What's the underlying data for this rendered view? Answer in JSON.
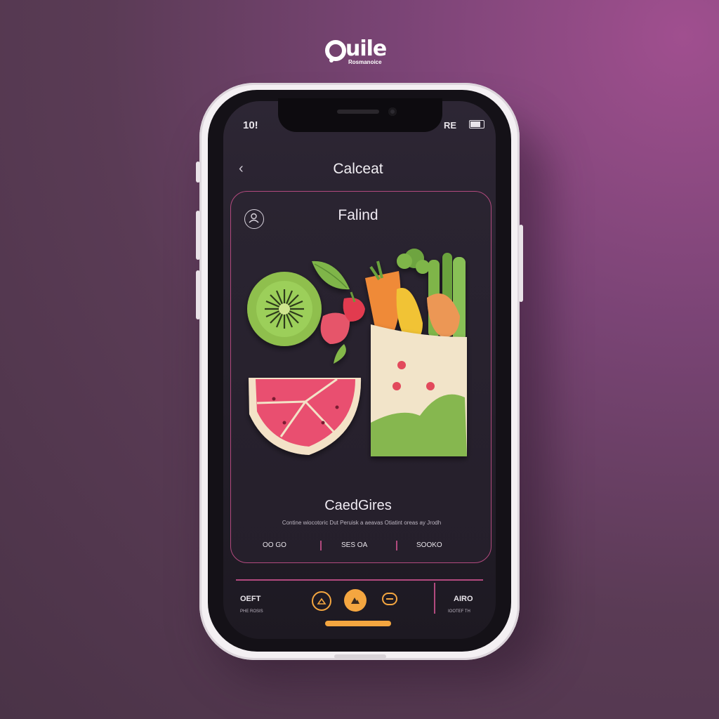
{
  "brand": {
    "logo_text": "uile",
    "logo_subtext": "Rosmanoice"
  },
  "status_bar": {
    "time": "10!",
    "signal_text": "RE"
  },
  "header": {
    "back_icon": "chevron-left-icon",
    "title": "Calceat"
  },
  "card": {
    "badge_icon": "profile-icon",
    "title": "Falind",
    "subtitle": "CaedGires",
    "description": "Contine wiocotoric Dut Peruisk a aeavas Otiatint oreas ay Jrodh",
    "stats": [
      "OO GO",
      "SES OA",
      "SOOKO"
    ]
  },
  "bottom_nav": {
    "left_label": "OEFT",
    "left_sub": "PHE ROSIS",
    "right_label": "AIRO",
    "right_sub": "IOOTEF TH",
    "buttons": [
      "timer-icon",
      "mountain-icon",
      "menu-icon"
    ]
  },
  "colors": {
    "accent": "#b24a7e",
    "orange": "#f4a640",
    "background": "#5a3b55",
    "screen": "#241f2a"
  }
}
